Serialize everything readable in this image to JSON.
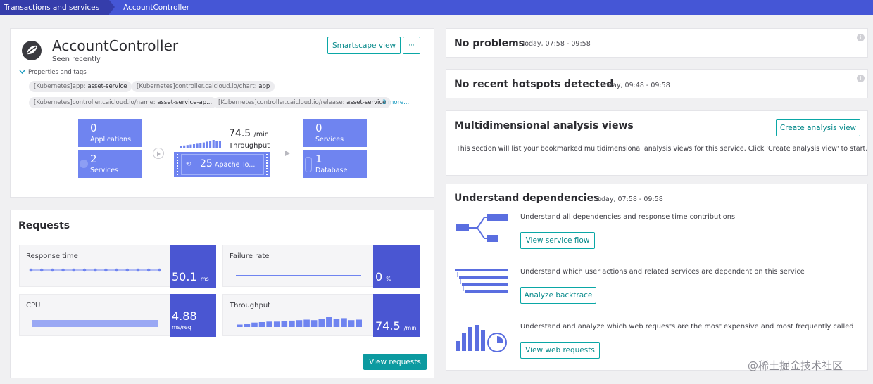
{
  "breadcrumb": {
    "first": "Transactions and services",
    "second": "AccountController"
  },
  "header": {
    "title": "AccountController",
    "subtitle": "Seen recently",
    "smartscape_label": "Smartscape view",
    "more_label": "···",
    "properties_label": "Properties and tags"
  },
  "tags": [
    {
      "key": "[Kubernetes]app:",
      "value": "asset-service"
    },
    {
      "key": "[Kubernetes]controller.caicloud.io/chart:",
      "value": "app"
    },
    {
      "key": "[Kubernetes]controller.caicloud.io/name:",
      "value": "asset-service-ap..."
    },
    {
      "key": "[Kubernetes]controller.caicloud.io/release:",
      "value": "asset-service"
    }
  ],
  "tags_more": "3 more...",
  "flow": {
    "applications": {
      "count": "0",
      "label": "Applications"
    },
    "services_in": {
      "count": "2",
      "label": "Services"
    },
    "throughput_value": "74.5",
    "throughput_unit": "/min",
    "throughput_label": "Throughput",
    "apache": {
      "count": "25",
      "label": "Apache To..."
    },
    "services_out": {
      "count": "0",
      "label": "Services"
    },
    "database": {
      "count": "1",
      "label": "Database"
    },
    "throughput_bars": [
      0.3,
      0.35,
      0.4,
      0.45,
      0.5,
      0.55,
      0.6,
      0.7,
      0.8,
      0.9,
      1.0,
      0.9,
      0.85
    ]
  },
  "requests": {
    "title": "Requests",
    "response_time": {
      "label": "Response time",
      "value": "50.1",
      "unit": "ms"
    },
    "failure_rate": {
      "label": "Failure rate",
      "value": "0",
      "unit": "%"
    },
    "cpu": {
      "label": "CPU",
      "value": "4.88",
      "unit": "ms/req"
    },
    "throughput": {
      "label": "Throughput",
      "value": "74.5",
      "unit": "/min"
    },
    "throughput_bars": [
      0.25,
      0.35,
      0.45,
      0.5,
      0.55,
      0.55,
      0.6,
      0.65,
      0.7,
      0.75,
      0.7,
      0.8,
      1.0,
      0.85,
      0.9,
      0.7,
      0.75
    ],
    "view_requests_label": "View requests"
  },
  "problems": {
    "title": "No problems",
    "time": "Today, 07:58 - 09:58"
  },
  "hotspots": {
    "title": "No recent hotspots detected",
    "time": "Today, 09:48 - 09:58"
  },
  "multidim": {
    "title": "Multidimensional analysis views",
    "create_label": "Create analysis view",
    "description": "This section will list your bookmarked multidimensional analysis views for this service. Click 'Create analysis view' to start."
  },
  "dependencies": {
    "title": "Understand dependencies",
    "time": "Today, 07:58 - 09:58",
    "items": [
      {
        "text": "Understand all dependencies and response time contributions",
        "button": "View service flow"
      },
      {
        "text": "Understand which user actions and related services are dependent on this service",
        "button": "Analyze backtrace"
      },
      {
        "text": "Understand and analyze which web requests are the most expensive and most frequently called",
        "button": "View web requests"
      }
    ]
  },
  "watermark": "@稀土掘金技术社区",
  "colors": {
    "accent": "#4556d6",
    "tile": "#6f84f0",
    "metric": "#4a56d2",
    "teal": "#0aa7a6"
  }
}
